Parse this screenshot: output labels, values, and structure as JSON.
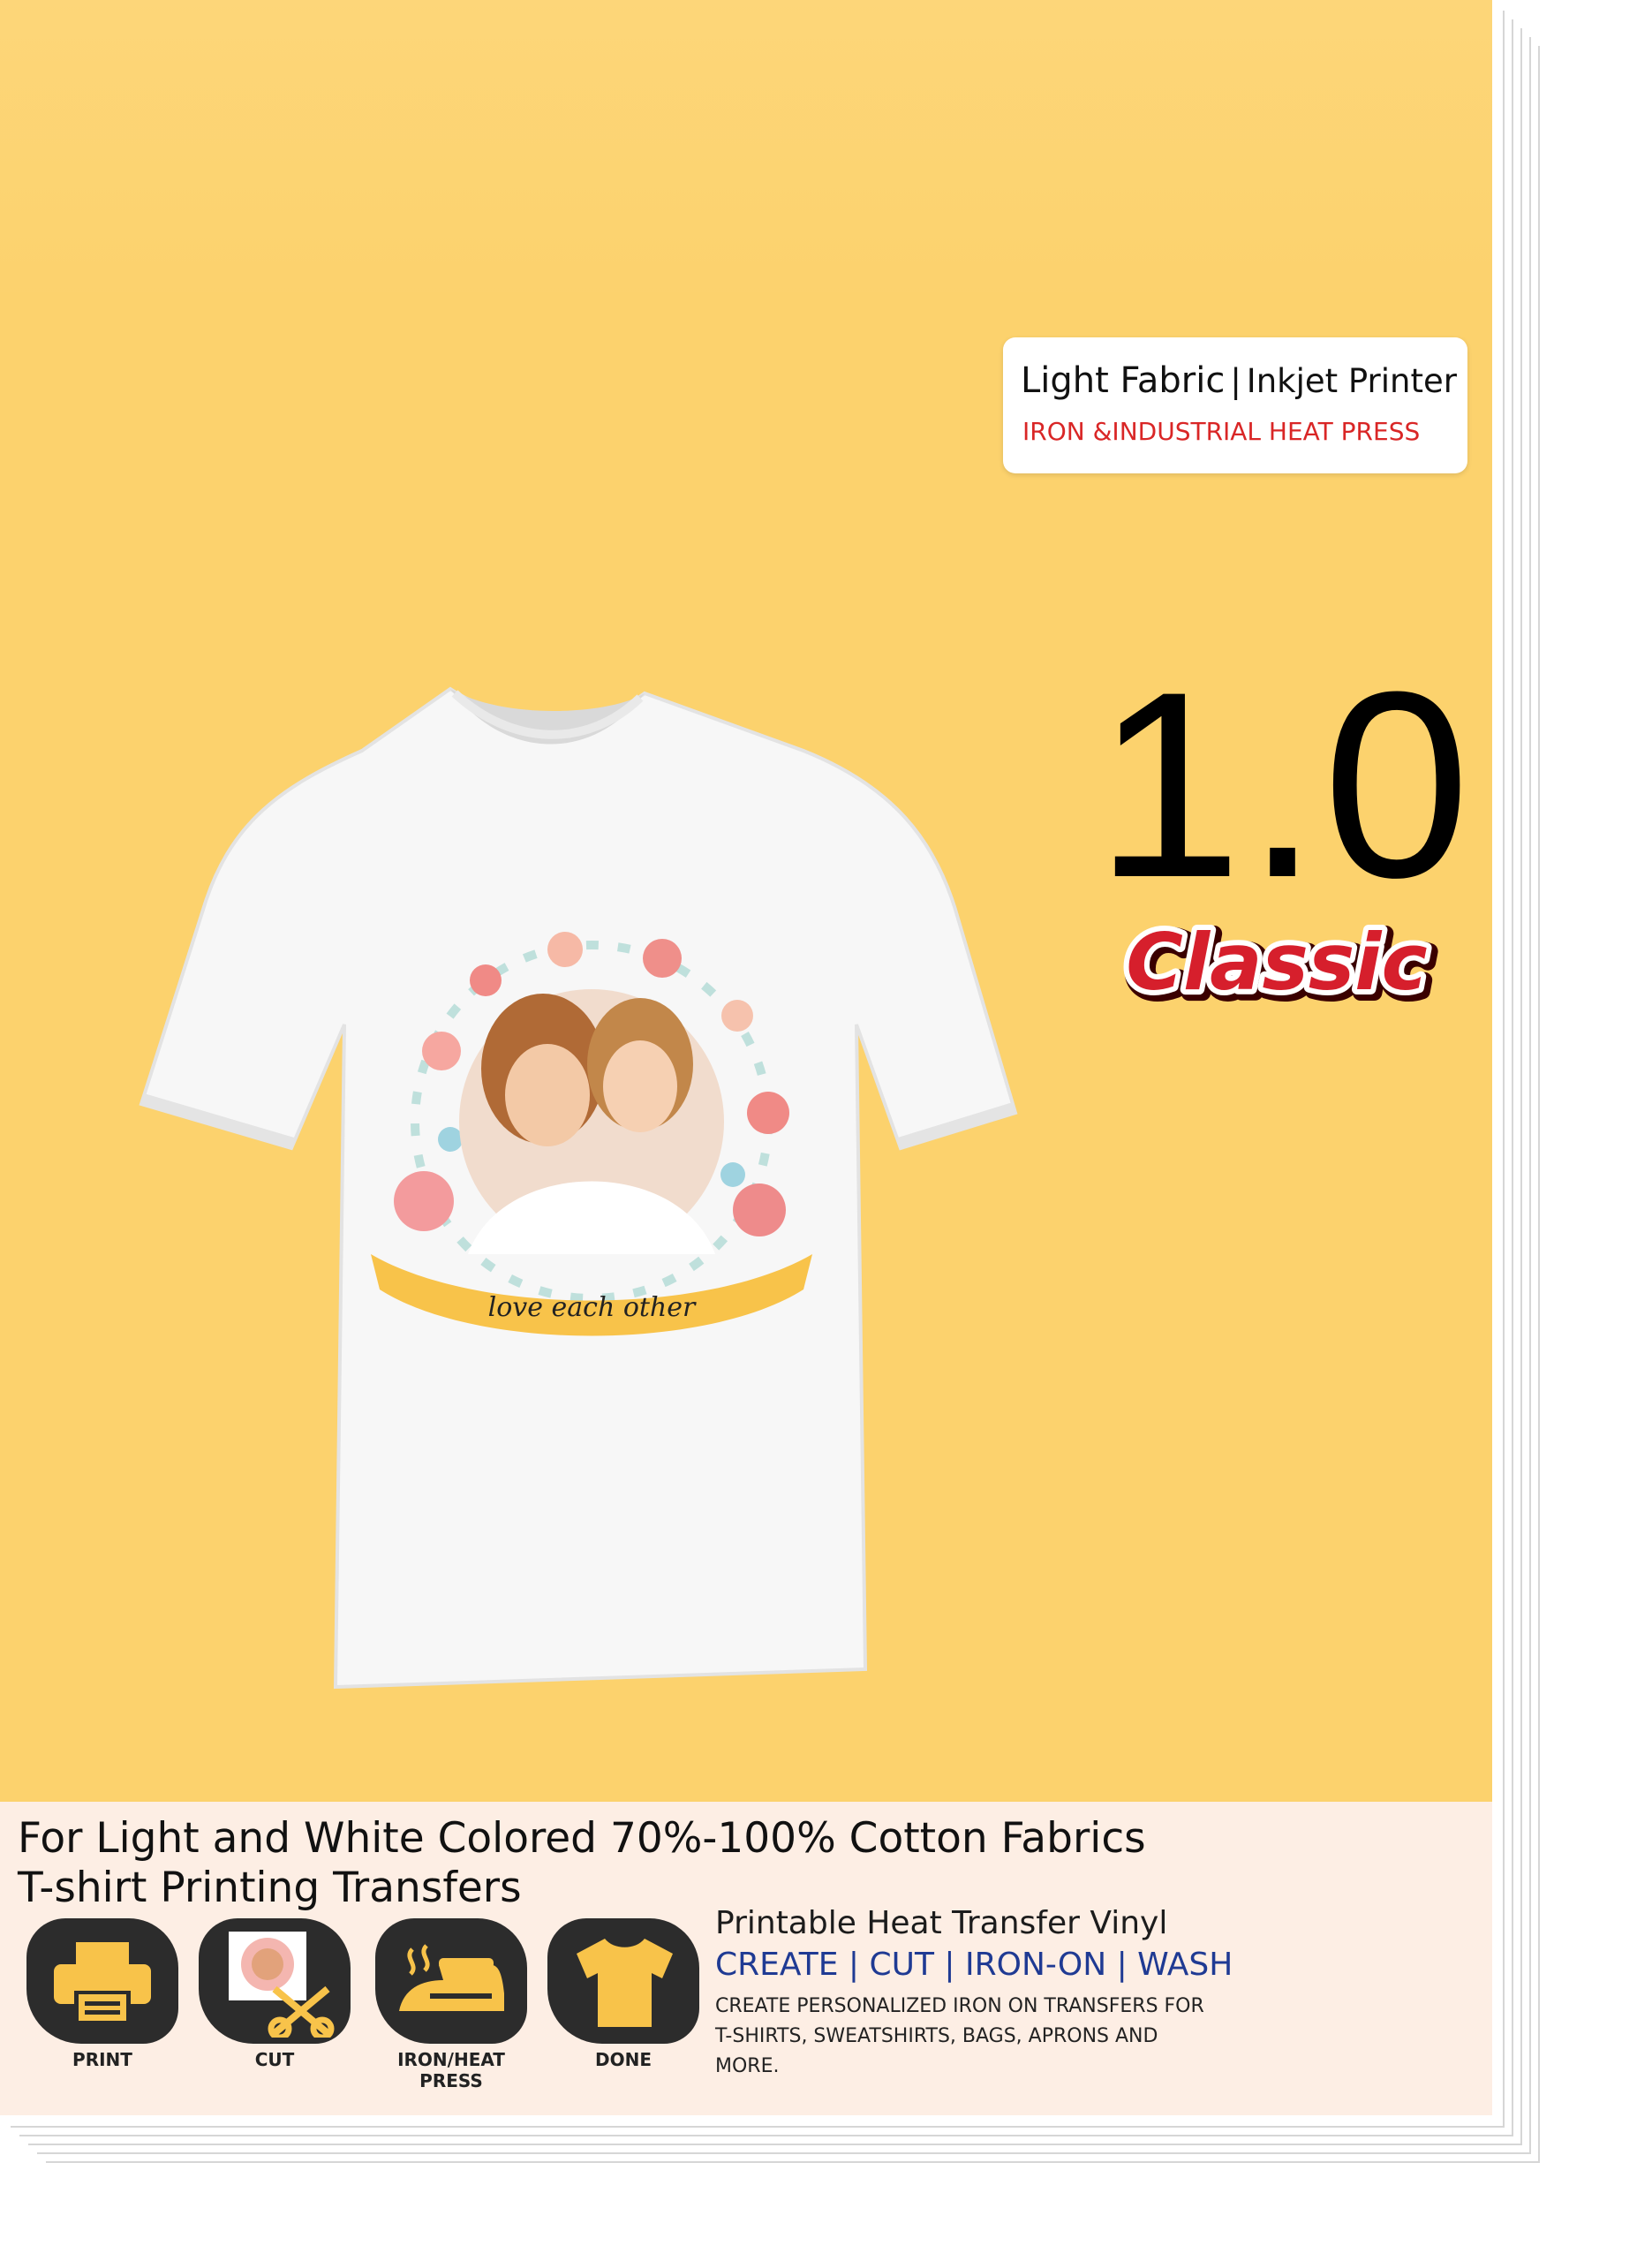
{
  "badge": {
    "fabric": "Light Fabric",
    "separator": "|",
    "printer": "Inkjet Printer",
    "heat": "IRON &INDUSTRIAL HEAT PRESS"
  },
  "version": "1.0",
  "edition": "Classic",
  "tshirt": {
    "banner_text": "love each other"
  },
  "headline": {
    "line1": "For Light and White Colored 70%-100% Cotton Fabrics",
    "line2": "T-shirt Printing Transfers"
  },
  "steps": [
    {
      "label": "PRINT",
      "icon": "printer-icon"
    },
    {
      "label": "CUT",
      "icon": "scissors-icon"
    },
    {
      "label": "IRON/HEAT PRESS",
      "icon": "iron-icon"
    },
    {
      "label": "DONE",
      "icon": "tshirt-icon"
    }
  ],
  "info": {
    "title": "Printable Heat Transfer Vinyl",
    "actions": "CREATE | CUT | IRON-ON | WASH",
    "desc": "CREATE PERSONALIZED IRON ON TRANSFERS FOR T-SHIRTS, SWEATSHIRTS, BAGS, APRONS AND MORE."
  },
  "colors": {
    "background": "#fcd26d",
    "band": "#fdeee4",
    "accent_red": "#d92626",
    "accent_blue": "#1f3a93",
    "icon_yellow": "#f8c34a"
  }
}
